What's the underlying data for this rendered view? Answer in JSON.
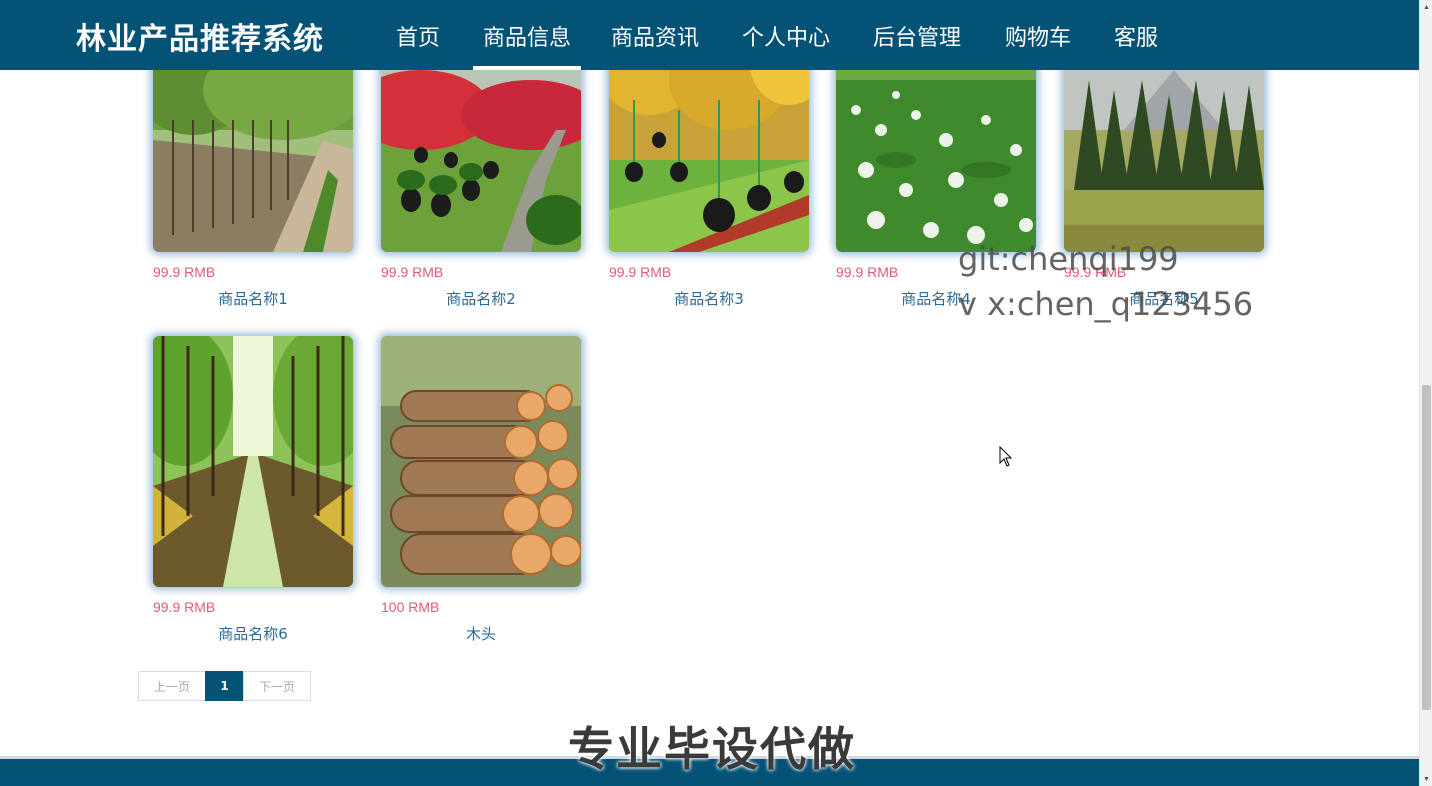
{
  "header": {
    "brand": "林业产品推荐系统",
    "nav": [
      {
        "label": "首页"
      },
      {
        "label": "商品信息",
        "active": true
      },
      {
        "label": "商品资讯"
      },
      {
        "label": "个人中心"
      },
      {
        "label": "后台管理"
      },
      {
        "label": "购物车"
      },
      {
        "label": "客服"
      }
    ],
    "bar_color": "#055277"
  },
  "products": [
    {
      "price": "99.9 RMB",
      "name": "商品名称1",
      "image": "nursery-trees-row"
    },
    {
      "price": "99.9 RMB",
      "name": "商品名称2",
      "image": "red-leaf-nursery"
    },
    {
      "price": "99.9 RMB",
      "name": "商品名称3",
      "image": "yellow-tree-saplings"
    },
    {
      "price": "99.9 RMB",
      "name": "商品名称4",
      "image": "flowering-field"
    },
    {
      "price": "99.9 RMB",
      "name": "商品名称5",
      "image": "conifer-forest-meadow"
    },
    {
      "price": "99.9 RMB",
      "name": "商品名称6",
      "image": "tree-lined-path"
    },
    {
      "price": "100 RMB",
      "name": "木头",
      "image": "stacked-logs"
    }
  ],
  "pagination": {
    "prev": "上一页",
    "current": "1",
    "next": "下一页"
  },
  "overlay": {
    "line1": "git:chenqi199",
    "line2": "v x:chen_q123456",
    "banner": "专业毕设代做"
  },
  "colors": {
    "price": "#e55a72",
    "name": "#2a6a98",
    "footer": "#055277"
  }
}
